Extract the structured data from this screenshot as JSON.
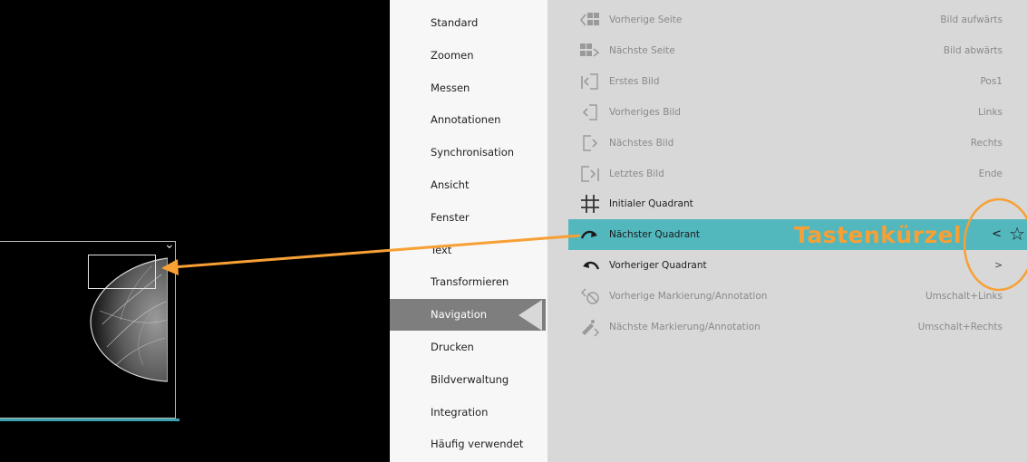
{
  "viewer": {
    "thumbnail_chevron": "⌄"
  },
  "categories": [
    {
      "label": "Standard",
      "active": false
    },
    {
      "label": "Zoomen",
      "active": false
    },
    {
      "label": "Messen",
      "active": false
    },
    {
      "label": "Annotationen",
      "active": false
    },
    {
      "label": "Synchronisation",
      "active": false
    },
    {
      "label": "Ansicht",
      "active": false
    },
    {
      "label": "Fenster",
      "active": false
    },
    {
      "label": "Text",
      "active": false
    },
    {
      "label": "Transformieren",
      "active": false
    },
    {
      "label": "Navigation",
      "active": true
    },
    {
      "label": "Drucken",
      "active": false
    },
    {
      "label": "Bildverwaltung",
      "active": false
    },
    {
      "label": "Integration",
      "active": false
    },
    {
      "label": "Häufig verwendet",
      "active": false
    }
  ],
  "commands": [
    {
      "label": "Vorherige Seite",
      "key": "Bild aufwärts",
      "icon": "previous-page-icon",
      "enabled": false
    },
    {
      "label": "Nächste Seite",
      "key": "Bild abwärts",
      "icon": "next-page-icon",
      "enabled": false
    },
    {
      "label": "Erstes Bild",
      "key": "Pos1",
      "icon": "first-image-icon",
      "enabled": false
    },
    {
      "label": "Vorheriges Bild",
      "key": "Links",
      "icon": "previous-image-icon",
      "enabled": false
    },
    {
      "label": "Nächstes Bild",
      "key": "Rechts",
      "icon": "next-image-icon",
      "enabled": false
    },
    {
      "label": "Letztes Bild",
      "key": "Ende",
      "icon": "last-image-icon",
      "enabled": false
    },
    {
      "label": "Initialer Quadrant",
      "key": "",
      "icon": "initial-quadrant-icon",
      "enabled": true
    },
    {
      "label": "Nächster Quadrant",
      "key": "<",
      "icon": "next-quadrant-icon",
      "enabled": true,
      "highlighted": true
    },
    {
      "label": "Vorheriger Quadrant",
      "key": ">",
      "icon": "previous-quadrant-icon",
      "enabled": true
    },
    {
      "label": "Vorherige Markierung/Annotation",
      "key": "Umschalt+Links",
      "icon": "previous-marking-icon",
      "enabled": false
    },
    {
      "label": "Nächste Markierung/Annotation",
      "key": "Umschalt+Rechts",
      "icon": "next-marking-icon",
      "enabled": false
    }
  ],
  "favorite_star": "☆",
  "annotation": {
    "title": "Tastenkürzel",
    "color": "#f7a035"
  },
  "colors": {
    "highlight": "#53b7be",
    "active_category": "#7e7e7e",
    "pane": "#d8d8d8",
    "accent_line": "#3aa3b0"
  }
}
